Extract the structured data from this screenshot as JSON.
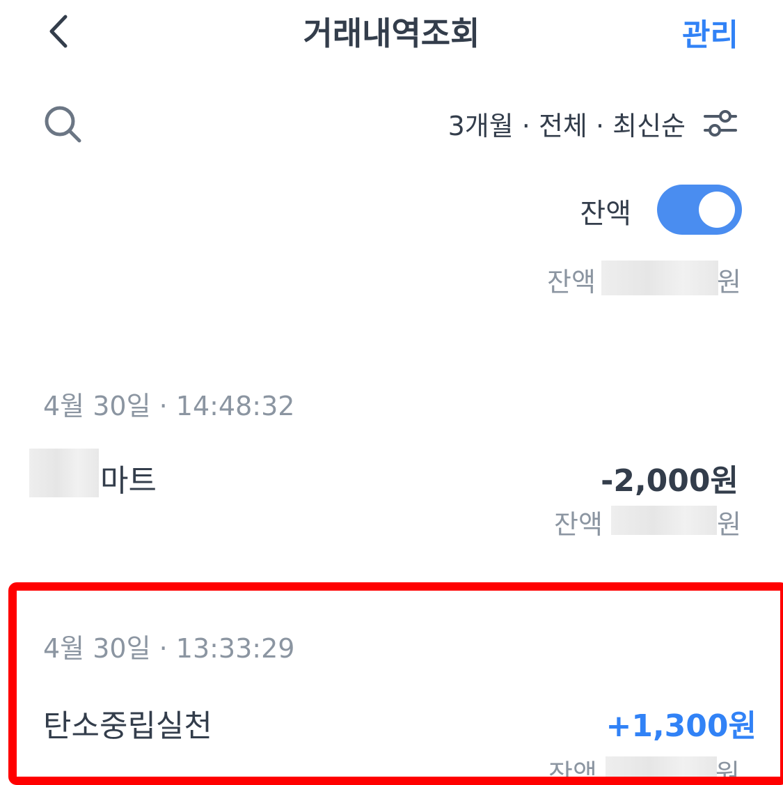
{
  "header": {
    "title": "거래내역조회",
    "manage_label": "관리"
  },
  "filter": {
    "summary": "3개월 · 전체 · 최신순"
  },
  "balance_toggle": {
    "label": "잔액",
    "on": true
  },
  "total_balance": {
    "label": "잔액",
    "unit": "원"
  },
  "transactions": [
    {
      "datetime": "4월 30일 · 14:48:32",
      "title_suffix": "마트",
      "amount": "-2,000원",
      "balance_label": "잔액",
      "balance_unit": "원"
    },
    {
      "datetime": "4월 30일 · 13:33:29",
      "title": "탄소중립실천",
      "amount": "+1,300원",
      "balance_label": "잔액",
      "balance_unit": "원"
    }
  ],
  "colors": {
    "accent": "#3182f6",
    "toggle": "#4a8df0",
    "highlight_border": "#ff0000",
    "muted_text": "#8b95a1",
    "primary_text": "#333d4b"
  },
  "icons": [
    "chevron-left-icon",
    "search-icon",
    "filter-sliders-icon"
  ]
}
